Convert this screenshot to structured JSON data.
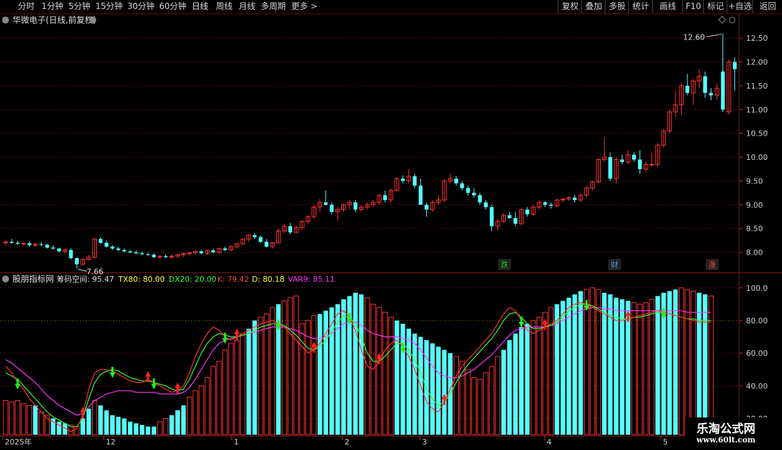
{
  "toolbar": {
    "periods": [
      "分时",
      "1分钟",
      "5分钟",
      "15分钟",
      "30分钟",
      "60分钟",
      "日线",
      "周线",
      "月线",
      "多周期",
      "更多 >"
    ],
    "active_period": "日线",
    "right_buttons": [
      "复权",
      "叠加",
      "多股",
      "统计",
      "画线",
      "F10",
      "标记",
      "+自选",
      "返回"
    ]
  },
  "main_panel": {
    "title": "华微电子(日线,前复权)",
    "max_label": "12.60",
    "min_label": "7.66",
    "y_ticks": [
      "12.50",
      "12.00",
      "11.50",
      "11.00",
      "10.50",
      "10.00",
      "9.50",
      "9.00",
      "8.50",
      "8.00"
    ],
    "markers": [
      {
        "text": "跌",
        "color": "#22cc22"
      },
      {
        "text": "财",
        "color": "#5599ff"
      },
      {
        "text": "涨",
        "color": "#ff5555"
      }
    ]
  },
  "indicator_panel": {
    "legend_name": "股朋指标网",
    "legend_items": [
      {
        "label": "筹码空间: 95.47",
        "color": "#e0e0e0"
      },
      {
        "label": "TX80: 80.00",
        "color": "#ffff33"
      },
      {
        "label": "DX20: 20.00",
        "color": "#33ff33"
      },
      {
        "label": "K: 79.42",
        "color": "#ff4444"
      },
      {
        "label": "D: 80.18",
        "color": "#ffff33"
      },
      {
        "label": "VAR9: 85.11",
        "color": "#ff33ff"
      }
    ],
    "y_ticks": [
      "100.0",
      "80.00",
      "60.00",
      "40.00",
      "20.00"
    ]
  },
  "date_axis": {
    "labels": [
      "2025年",
      "12",
      "1",
      "2",
      "3",
      "4",
      "5"
    ]
  },
  "watermark": {
    "title": "乐淘公式网",
    "url": "www.60lt.com"
  },
  "colors": {
    "up": "#ff3333",
    "down": "#55ffff",
    "grid": "#7a1a1a",
    "k_line": "#ff3333",
    "d_line": "#33ff33",
    "var9_line": "#ff33ff"
  },
  "chart_data": {
    "type": "candlestick",
    "price_axis": {
      "min": 7.6,
      "max": 12.75
    },
    "indicator_axis": {
      "min": 10,
      "max": 105
    },
    "candles": [
      [
        8.2,
        8.25,
        8.15,
        8.22
      ],
      [
        8.22,
        8.28,
        8.18,
        8.2
      ],
      [
        8.2,
        8.24,
        8.16,
        8.18
      ],
      [
        8.18,
        8.22,
        8.14,
        8.19
      ],
      [
        8.19,
        8.22,
        8.12,
        8.15
      ],
      [
        8.15,
        8.2,
        8.12,
        8.17
      ],
      [
        8.17,
        8.22,
        8.13,
        8.16
      ],
      [
        8.16,
        8.18,
        8.08,
        8.1
      ],
      [
        8.1,
        8.15,
        8.06,
        8.08
      ],
      [
        8.08,
        8.1,
        8.0,
        8.02
      ],
      [
        8.02,
        8.08,
        7.98,
        8.05
      ],
      [
        8.05,
        8.08,
        7.85,
        7.88
      ],
      [
        7.88,
        7.9,
        7.66,
        7.75
      ],
      [
        7.75,
        7.88,
        7.72,
        7.85
      ],
      [
        7.85,
        7.95,
        7.82,
        7.9
      ],
      [
        7.9,
        8.3,
        7.88,
        8.28
      ],
      [
        8.28,
        8.32,
        8.18,
        8.2
      ],
      [
        8.2,
        8.25,
        8.1,
        8.12
      ],
      [
        8.12,
        8.15,
        8.05,
        8.08
      ],
      [
        8.08,
        8.12,
        8.02,
        8.05
      ],
      [
        8.05,
        8.08,
        8.0,
        8.02
      ],
      [
        8.02,
        8.05,
        7.98,
        8.0
      ],
      [
        8.0,
        8.04,
        7.96,
        7.98
      ],
      [
        7.98,
        8.02,
        7.94,
        7.96
      ],
      [
        7.96,
        8.0,
        7.92,
        7.95
      ],
      [
        7.95,
        7.98,
        7.88,
        7.9
      ],
      [
        7.9,
        7.94,
        7.86,
        7.92
      ],
      [
        7.92,
        7.96,
        7.88,
        7.9
      ],
      [
        7.9,
        7.95,
        7.86,
        7.92
      ],
      [
        7.92,
        7.97,
        7.88,
        7.95
      ],
      [
        7.95,
        8.0,
        7.9,
        7.97
      ],
      [
        7.97,
        8.02,
        7.93,
        7.99
      ],
      [
        7.99,
        8.04,
        7.95,
        8.02
      ],
      [
        8.02,
        8.05,
        7.96,
        7.98
      ],
      [
        7.98,
        8.06,
        7.95,
        8.04
      ],
      [
        8.04,
        8.08,
        7.98,
        8.0
      ],
      [
        8.0,
        8.1,
        7.97,
        8.08
      ],
      [
        8.08,
        8.12,
        8.02,
        8.05
      ],
      [
        8.05,
        8.15,
        8.03,
        8.12
      ],
      [
        8.12,
        8.2,
        8.08,
        8.18
      ],
      [
        8.18,
        8.3,
        8.15,
        8.28
      ],
      [
        8.28,
        8.38,
        8.22,
        8.36
      ],
      [
        8.36,
        8.4,
        8.28,
        8.32
      ],
      [
        8.32,
        8.35,
        8.2,
        8.22
      ],
      [
        8.22,
        8.28,
        8.1,
        8.12
      ],
      [
        8.12,
        8.22,
        8.08,
        8.2
      ],
      [
        8.2,
        8.5,
        8.18,
        8.45
      ],
      [
        8.45,
        8.6,
        8.4,
        8.55
      ],
      [
        8.55,
        8.62,
        8.38,
        8.42
      ],
      [
        8.42,
        8.56,
        8.4,
        8.52
      ],
      [
        8.52,
        8.68,
        8.48,
        8.65
      ],
      [
        8.65,
        8.78,
        8.6,
        8.75
      ],
      [
        8.75,
        9.0,
        8.7,
        8.95
      ],
      [
        8.95,
        9.12,
        8.85,
        9.05
      ],
      [
        9.05,
        9.3,
        8.98,
        9.0
      ],
      [
        9.0,
        9.05,
        8.8,
        8.85
      ],
      [
        8.85,
        8.95,
        8.65,
        8.9
      ],
      [
        8.9,
        9.02,
        8.85,
        9.0
      ],
      [
        9.0,
        9.1,
        8.9,
        9.05
      ],
      [
        9.05,
        9.1,
        8.85,
        8.9
      ],
      [
        8.9,
        9.0,
        8.85,
        8.95
      ],
      [
        8.95,
        9.05,
        8.9,
        9.0
      ],
      [
        9.0,
        9.1,
        8.95,
        9.05
      ],
      [
        9.05,
        9.22,
        9.0,
        9.2
      ],
      [
        9.2,
        9.3,
        9.05,
        9.1
      ],
      [
        9.1,
        9.35,
        9.05,
        9.3
      ],
      [
        9.3,
        9.58,
        9.28,
        9.55
      ],
      [
        9.55,
        9.62,
        9.45,
        9.5
      ],
      [
        9.5,
        9.75,
        9.45,
        9.6
      ],
      [
        9.6,
        9.65,
        9.35,
        9.4
      ],
      [
        9.4,
        9.55,
        9.0,
        9.0
      ],
      [
        9.0,
        9.05,
        8.75,
        8.9
      ],
      [
        8.9,
        9.1,
        8.85,
        9.05
      ],
      [
        9.05,
        9.2,
        9.0,
        9.1
      ],
      [
        9.1,
        9.55,
        9.05,
        9.5
      ],
      [
        9.5,
        9.65,
        9.45,
        9.55
      ],
      [
        9.55,
        9.6,
        9.4,
        9.45
      ],
      [
        9.45,
        9.5,
        9.3,
        9.35
      ],
      [
        9.35,
        9.4,
        9.2,
        9.25
      ],
      [
        9.25,
        9.35,
        9.15,
        9.2
      ],
      [
        9.2,
        9.25,
        9.0,
        9.05
      ],
      [
        9.05,
        9.1,
        8.9,
        8.95
      ],
      [
        8.95,
        9.0,
        8.45,
        8.55
      ],
      [
        8.55,
        8.7,
        8.45,
        8.65
      ],
      [
        8.65,
        8.82,
        8.62,
        8.78
      ],
      [
        8.78,
        8.85,
        8.7,
        8.72
      ],
      [
        8.72,
        8.85,
        8.55,
        8.6
      ],
      [
        8.6,
        8.92,
        8.58,
        8.9
      ],
      [
        8.9,
        8.95,
        8.75,
        8.8
      ],
      [
        8.8,
        9.0,
        8.78,
        8.95
      ],
      [
        8.95,
        9.1,
        8.9,
        9.05
      ],
      [
        9.05,
        9.08,
        8.95,
        9.0
      ],
      [
        9.0,
        9.05,
        8.92,
        8.98
      ],
      [
        8.98,
        9.12,
        8.95,
        9.1
      ],
      [
        9.1,
        9.15,
        9.05,
        9.12
      ],
      [
        9.12,
        9.18,
        9.08,
        9.15
      ],
      [
        9.15,
        9.2,
        9.05,
        9.1
      ],
      [
        9.1,
        9.25,
        9.05,
        9.2
      ],
      [
        9.2,
        9.4,
        9.15,
        9.35
      ],
      [
        9.35,
        9.5,
        9.3,
        9.48
      ],
      [
        9.48,
        9.98,
        9.45,
        9.95
      ],
      [
        9.95,
        10.42,
        9.9,
        10.0
      ],
      [
        10.0,
        10.1,
        9.5,
        9.55
      ],
      [
        9.55,
        10.0,
        9.45,
        9.95
      ],
      [
        9.95,
        10.05,
        9.85,
        9.9
      ],
      [
        9.9,
        10.15,
        9.85,
        10.05
      ],
      [
        10.05,
        10.1,
        9.9,
        9.95
      ],
      [
        9.95,
        10.15,
        9.65,
        9.75
      ],
      [
        9.75,
        9.9,
        9.7,
        9.85
      ],
      [
        9.85,
        10.1,
        9.8,
        9.85
      ],
      [
        9.85,
        10.3,
        9.8,
        10.25
      ],
      [
        10.25,
        10.6,
        10.2,
        10.55
      ],
      [
        10.55,
        11.0,
        10.5,
        10.95
      ],
      [
        10.95,
        11.4,
        10.85,
        11.1
      ],
      [
        11.1,
        11.55,
        10.9,
        11.5
      ],
      [
        11.5,
        11.75,
        11.3,
        11.35
      ],
      [
        11.35,
        11.65,
        11.1,
        11.6
      ],
      [
        11.6,
        11.85,
        11.45,
        11.7
      ],
      [
        11.7,
        11.8,
        11.25,
        11.35
      ],
      [
        11.35,
        11.45,
        11.2,
        11.3
      ],
      [
        11.3,
        11.55,
        11.2,
        11.45
      ],
      [
        11.8,
        12.6,
        10.95,
        11.0
      ],
      [
        10.95,
        12.05,
        10.9,
        12.0
      ],
      [
        12.0,
        12.1,
        11.4,
        11.85
      ]
    ],
    "chip_space": [
      31,
      30,
      31,
      29,
      28,
      28,
      24,
      22,
      20,
      18,
      17,
      16,
      15,
      20,
      26,
      31,
      28,
      25,
      22,
      21,
      20,
      18,
      17,
      16,
      15,
      15,
      18,
      20,
      22,
      25,
      28,
      33,
      37,
      40,
      45,
      52,
      55,
      62,
      66,
      68,
      72,
      75,
      80,
      82,
      84,
      88,
      90,
      92,
      94,
      95,
      78,
      80,
      83,
      84,
      86,
      88,
      90,
      93,
      95,
      97,
      96,
      94,
      90,
      88,
      85,
      82,
      80,
      78,
      75,
      72,
      70,
      68,
      66,
      64,
      62,
      60,
      58,
      55,
      50,
      45,
      44,
      48,
      52,
      58,
      62,
      68,
      72,
      76,
      78,
      80,
      82,
      85,
      88,
      90,
      92,
      94,
      96,
      98,
      99,
      100,
      99,
      97,
      96,
      94,
      93,
      92,
      91,
      90,
      91,
      93,
      95,
      97,
      98,
      99,
      100,
      99,
      98,
      97,
      96,
      95
    ],
    "chip_cyan": [
      0,
      0,
      0,
      0,
      0,
      1,
      0,
      0,
      1,
      1,
      1,
      0,
      0,
      1,
      1,
      0,
      1,
      1,
      1,
      1,
      1,
      1,
      1,
      1,
      1,
      1,
      0,
      0,
      1,
      1,
      1,
      0,
      0,
      0,
      0,
      0,
      0,
      0,
      0,
      0,
      0,
      1,
      1,
      0,
      0,
      0,
      1,
      0,
      0,
      0,
      0,
      0,
      0,
      1,
      1,
      1,
      1,
      1,
      1,
      1,
      1,
      0,
      0,
      0,
      0,
      0,
      1,
      1,
      1,
      1,
      1,
      1,
      1,
      1,
      1,
      1,
      0,
      0,
      0,
      0,
      0,
      0,
      0,
      0,
      1,
      1,
      1,
      1,
      1,
      0,
      0,
      0,
      0,
      1,
      1,
      1,
      1,
      1,
      0,
      0,
      0,
      1,
      1,
      1,
      1,
      1,
      0,
      0,
      0,
      0,
      1,
      1,
      1,
      1,
      0,
      0,
      0,
      1,
      1,
      0
    ],
    "k": [
      52,
      48,
      42,
      38,
      32,
      28,
      24,
      20,
      18,
      16,
      14,
      12,
      14,
      22,
      38,
      48,
      50,
      50,
      49,
      47,
      45,
      43,
      42,
      42,
      44,
      42,
      40,
      38,
      36,
      37,
      40,
      48,
      58,
      66,
      72,
      76,
      74,
      70,
      68,
      70,
      72,
      74,
      76,
      78,
      79,
      80,
      78,
      76,
      72,
      68,
      64,
      60,
      62,
      66,
      72,
      78,
      84,
      86,
      82,
      74,
      62,
      52,
      50,
      55,
      62,
      66,
      68,
      64,
      58,
      50,
      40,
      30,
      26,
      24,
      30,
      38,
      46,
      52,
      56,
      60,
      64,
      68,
      72,
      78,
      84,
      88,
      86,
      80,
      74,
      72,
      74,
      76,
      78,
      80,
      84,
      88,
      90,
      91,
      90,
      88,
      86,
      84,
      82,
      80,
      80,
      81,
      82,
      83,
      84,
      85,
      86,
      85,
      84,
      83,
      82,
      81,
      80,
      79,
      79,
      79
    ],
    "d": [
      48,
      46,
      44,
      40,
      36,
      32,
      28,
      24,
      21,
      19,
      17,
      15,
      15,
      20,
      32,
      42,
      47,
      49,
      50,
      49,
      47,
      45,
      44,
      43,
      43,
      42,
      41,
      40,
      38,
      37,
      38,
      44,
      52,
      60,
      66,
      70,
      72,
      71,
      70,
      70,
      71,
      72,
      74,
      76,
      77,
      78,
      78,
      77,
      74,
      71,
      67,
      63,
      62,
      64,
      68,
      73,
      79,
      83,
      82,
      78,
      70,
      60,
      55,
      55,
      58,
      62,
      66,
      66,
      62,
      56,
      48,
      38,
      32,
      28,
      30,
      35,
      42,
      48,
      53,
      57,
      61,
      65,
      69,
      74,
      80,
      84,
      85,
      82,
      78,
      75,
      75,
      76,
      77,
      79,
      82,
      86,
      88,
      90,
      90,
      89,
      87,
      85,
      83,
      82,
      81,
      81,
      82,
      82,
      83,
      84,
      85,
      85,
      84,
      83,
      82,
      81,
      81,
      80,
      80,
      80
    ],
    "var9": [
      56,
      54,
      51,
      48,
      45,
      42,
      38,
      34,
      31,
      28,
      26,
      24,
      22,
      23,
      27,
      31,
      33,
      35,
      36,
      37,
      37,
      37,
      36,
      36,
      36,
      36,
      35,
      35,
      35,
      35,
      36,
      39,
      44,
      50,
      56,
      62,
      66,
      68,
      69,
      70,
      71,
      72,
      73,
      74,
      75,
      76,
      76,
      76,
      75,
      74,
      72,
      70,
      69,
      69,
      70,
      72,
      75,
      78,
      79,
      79,
      77,
      74,
      72,
      71,
      70,
      70,
      70,
      69,
      68,
      66,
      62,
      57,
      52,
      48,
      46,
      45,
      45,
      46,
      48,
      50,
      53,
      56,
      59,
      63,
      67,
      71,
      74,
      75,
      76,
      76,
      76,
      76,
      77,
      78,
      80,
      82,
      84,
      86,
      87,
      88,
      88,
      87,
      87,
      86,
      86,
      86,
      86,
      86,
      86,
      86,
      86,
      86,
      86,
      86,
      86,
      85,
      85,
      85,
      85,
      85
    ]
  }
}
